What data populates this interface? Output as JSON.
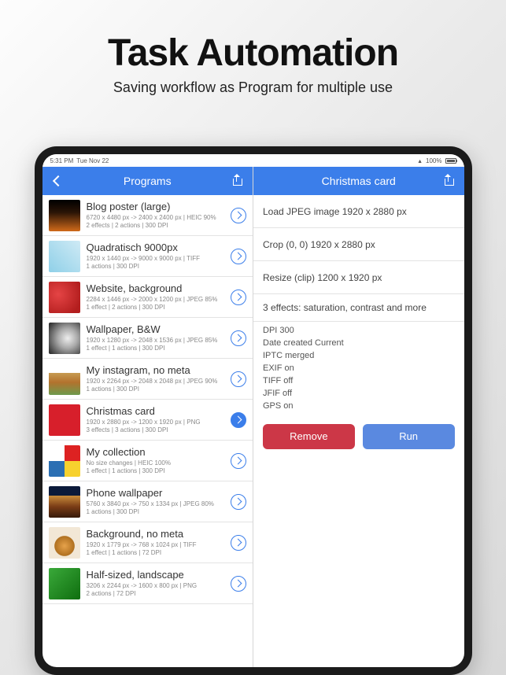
{
  "promo": {
    "title": "Task Automation",
    "subtitle": "Saving workflow as Program for multiple use"
  },
  "status": {
    "time": "5:31 PM",
    "date": "Tue Nov 22",
    "battery": "100%"
  },
  "left": {
    "title": "Programs",
    "items": [
      {
        "title": "Blog poster (large)",
        "sub": "6720 x 4480 px -> 2400 x 2400 px | HEIC 90%\n2 effects | 2 actions | 300 DPI",
        "thumb": "t0",
        "selected": false
      },
      {
        "title": "Quadratisch 9000px",
        "sub": "1920 x 1440 px -> 9000 x 9000 px | TIFF\n1 actions | 300 DPI",
        "thumb": "t1",
        "selected": false
      },
      {
        "title": "Website, background",
        "sub": "2284 x 1446 px -> 2000 x 1200 px | JPEG 85%\n1 effect | 2 actions | 300 DPI",
        "thumb": "t2",
        "selected": false
      },
      {
        "title": "Wallpaper, B&W",
        "sub": "1920 x 1280 px -> 2048 x 1536 px | JPEG 85%\n1 effect | 1 actions | 300 DPI",
        "thumb": "t3",
        "selected": false
      },
      {
        "title": "My instagram, no meta",
        "sub": "1920 x 2264 px -> 2048 x 2048 px | JPEG 90%\n1 actions | 300 DPI",
        "thumb": "t4",
        "selected": false
      },
      {
        "title": "Christmas card",
        "sub": "1920 x 2880 px -> 1200 x 1920 px | PNG\n3 effects | 3 actions | 300 DPI",
        "thumb": "t5",
        "selected": true
      },
      {
        "title": "My collection",
        "sub": "No size changes | HEIC 100%\n1 effect | 1 actions | 300 DPI",
        "thumb": "t6",
        "selected": false
      },
      {
        "title": "Phone wallpaper",
        "sub": "5760 x 3840 px -> 750 x 1334 px | JPEG 80%\n1 actions | 300 DPI",
        "thumb": "t7",
        "selected": false
      },
      {
        "title": "Background, no meta",
        "sub": "1920 x 1779 px -> 768 x 1024 px | TIFF\n1 effect | 1 actions | 72 DPI",
        "thumb": "t8",
        "selected": false
      },
      {
        "title": "Half-sized, landscape",
        "sub": "3206 x 2244 px -> 1600 x 800 px | PNG\n2 actions | 72 DPI",
        "thumb": "t9",
        "selected": false
      }
    ]
  },
  "right": {
    "title": "Christmas card",
    "steps": [
      "Load JPEG image 1920 x 2880 px",
      "Crop (0, 0) 1920 x 2880 px",
      "Resize (clip) 1200 x 1920 px"
    ],
    "effects": "3 effects: saturation, contrast and more",
    "meta": [
      "DPI 300",
      "Date created Current",
      "IPTC merged",
      "EXIF on",
      "TIFF off",
      "JFIF off",
      "GPS on"
    ],
    "remove": "Remove",
    "run": "Run"
  }
}
